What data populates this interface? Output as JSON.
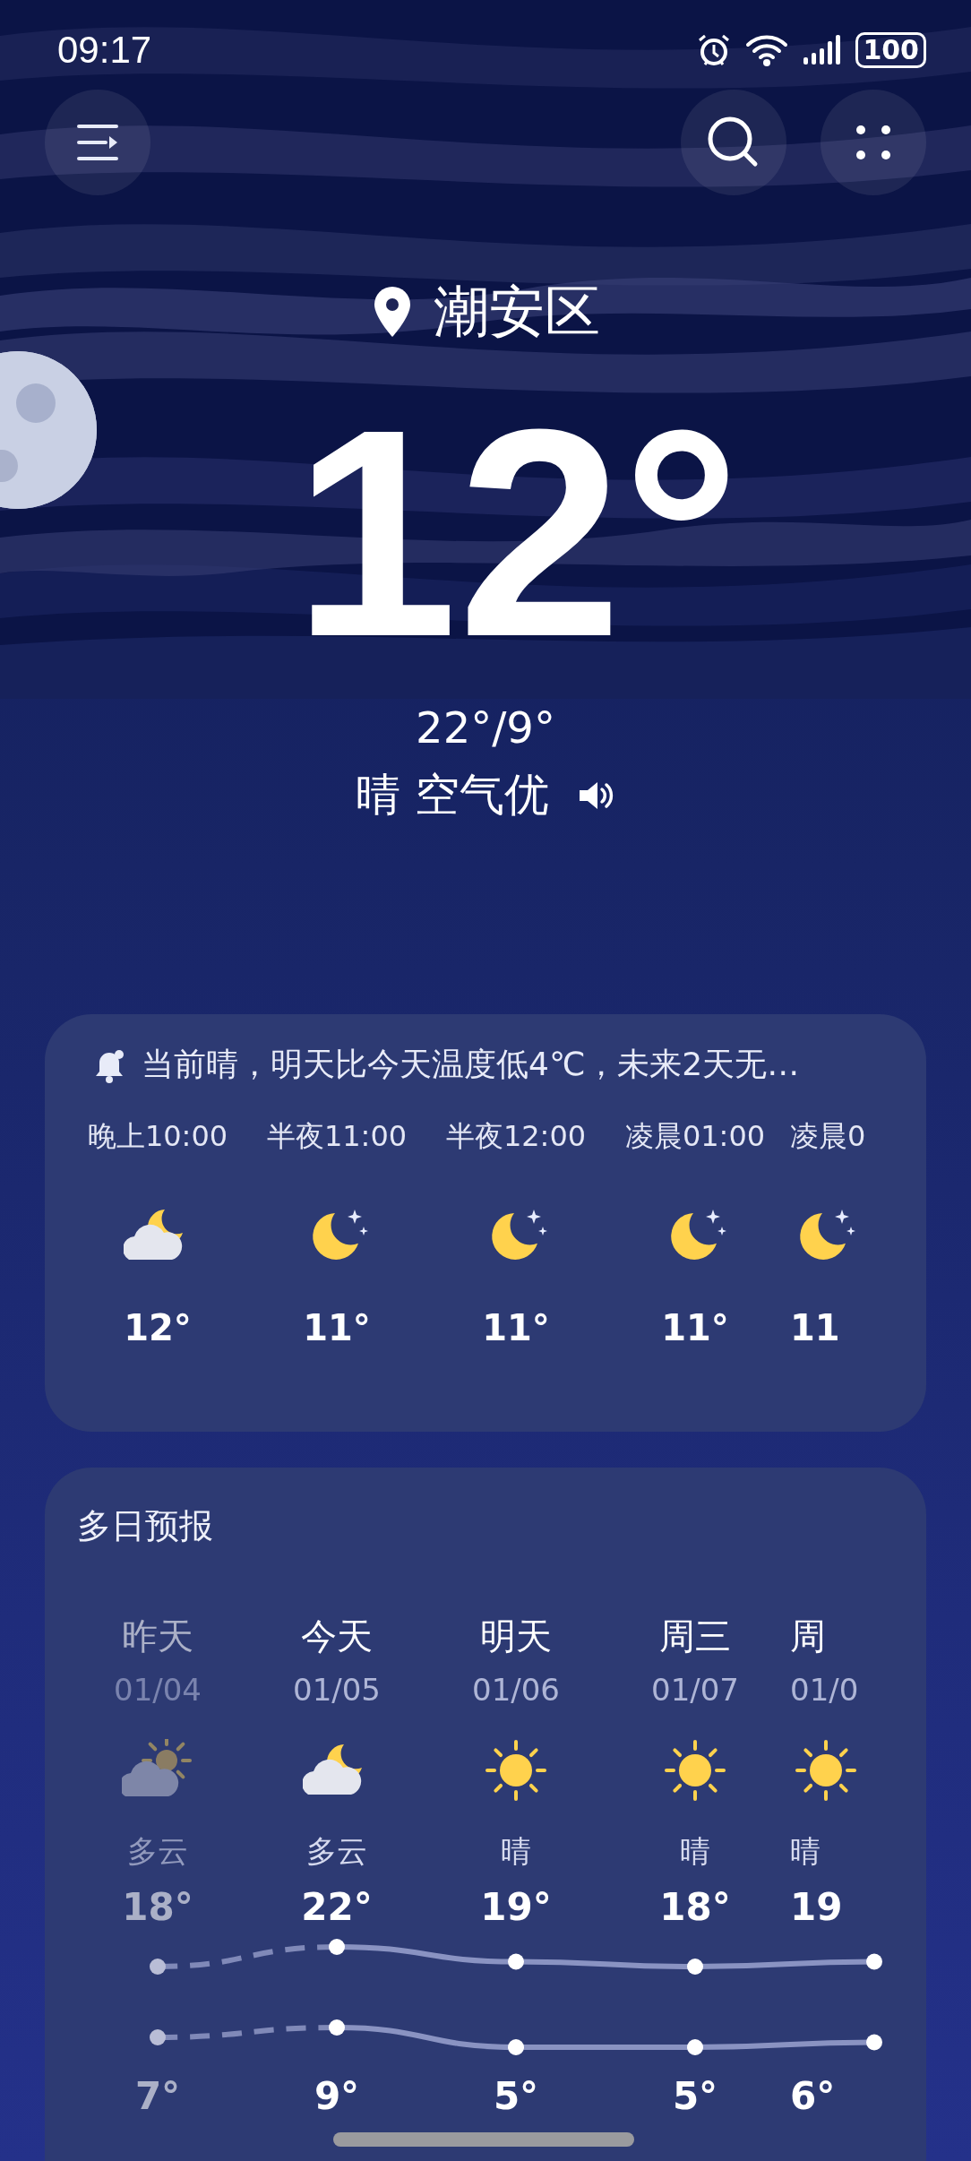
{
  "status_bar": {
    "time": "09:17",
    "battery": "100"
  },
  "location": {
    "name": "潮安区"
  },
  "current": {
    "temperature": "12°",
    "range": "22°/9°",
    "summary": "晴 空气优"
  },
  "hourly_card": {
    "alert": "当前晴，明天比今天温度低4℃，未来2天无…",
    "hours": [
      {
        "time": "晚上10:00",
        "kind": "cloud-moon",
        "temp": "12°"
      },
      {
        "time": "半夜11:00",
        "kind": "moon-stars",
        "temp": "11°"
      },
      {
        "time": "半夜12:00",
        "kind": "moon-stars",
        "temp": "11°"
      },
      {
        "time": "凌晨01:00",
        "kind": "moon-stars",
        "temp": "11°"
      },
      {
        "time": "凌晨0",
        "kind": "moon-stars",
        "temp": "11"
      }
    ]
  },
  "daily_card": {
    "title": "多日预报",
    "days": [
      {
        "day": "昨天",
        "date": "01/04",
        "kind": "cloud-sun",
        "condition": "多云",
        "high": "18°",
        "low": "7°",
        "past": true
      },
      {
        "day": "今天",
        "date": "01/05",
        "kind": "cloud-moon",
        "condition": "多云",
        "high": "22°",
        "low": "9°",
        "past": false
      },
      {
        "day": "明天",
        "date": "01/06",
        "kind": "sun",
        "condition": "晴",
        "high": "19°",
        "low": "5°",
        "past": false
      },
      {
        "day": "周三",
        "date": "01/07",
        "kind": "sun",
        "condition": "晴",
        "high": "18°",
        "low": "5°",
        "past": false
      },
      {
        "day": "周",
        "date": "01/0",
        "kind": "sun",
        "condition": "晴",
        "high": "19",
        "low": "6°",
        "past": false
      }
    ]
  }
}
